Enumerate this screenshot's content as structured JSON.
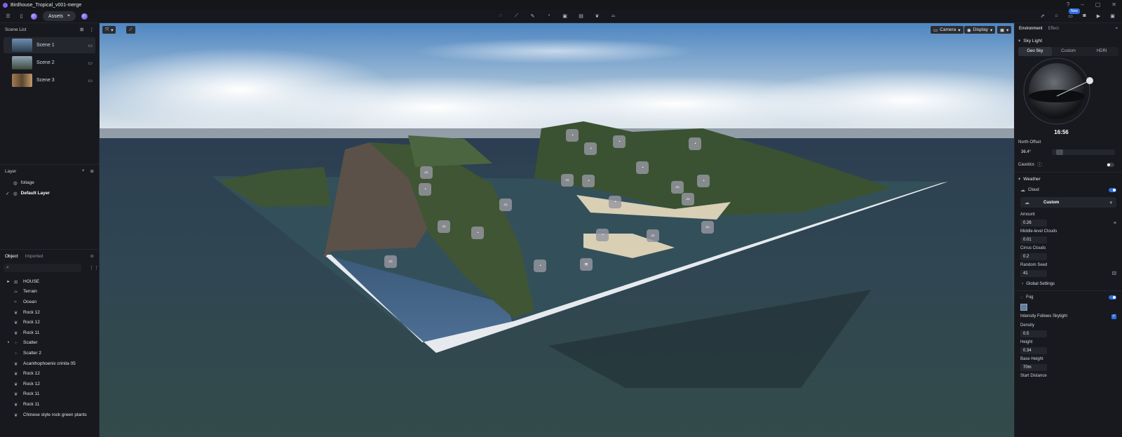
{
  "app": {
    "title": "Birdhouse_Tropical_v001-merge"
  },
  "toolbar": {
    "assets_label": "Assets",
    "new_badge": "New"
  },
  "scene_list": {
    "header": "Scene List",
    "scenes": [
      {
        "label": "Scene 1"
      },
      {
        "label": "Scene 2"
      },
      {
        "label": "Scene 3"
      }
    ]
  },
  "layer": {
    "header": "Layer",
    "items": [
      {
        "label": "foliage"
      },
      {
        "label": "Default Layer"
      }
    ]
  },
  "object_panel": {
    "tabs": [
      "Object",
      "Imported"
    ],
    "items": [
      {
        "label": "HOUSE",
        "icon": "group-icon"
      },
      {
        "label": "Terrain",
        "icon": "terrain-icon"
      },
      {
        "label": "Ocean",
        "icon": "ocean-icon"
      },
      {
        "label": "Rock 12",
        "icon": "leaf-icon"
      },
      {
        "label": "Rock 12",
        "icon": "leaf-icon"
      },
      {
        "label": "Rock 11",
        "icon": "leaf-icon"
      },
      {
        "label": "Scatter",
        "icon": "scatter-icon"
      },
      {
        "label": "Scatter 2",
        "icon": "scatter-icon"
      },
      {
        "label": "Acanthophoenix crinita 05",
        "icon": "leaf-icon"
      },
      {
        "label": "Rock 12",
        "icon": "leaf-icon"
      },
      {
        "label": "Rock 12",
        "icon": "leaf-icon"
      },
      {
        "label": "Rock 11",
        "icon": "leaf-icon"
      },
      {
        "label": "Rock 11",
        "icon": "leaf-icon"
      },
      {
        "label": "Chinese style rock green plants",
        "icon": "leaf-icon"
      }
    ]
  },
  "viewport": {
    "camera_label": "Camera",
    "display_label": "Display"
  },
  "right_panel": {
    "tabs": [
      "Environment",
      "Effect"
    ],
    "sky_light": {
      "header": "Sky Light",
      "modes": [
        "Geo Sky",
        "Custom",
        "HDRI"
      ],
      "time": "16:56",
      "north_offset_label": "North Offset",
      "north_offset_value": "36.4°",
      "caustics_label": "Caustics"
    },
    "weather": {
      "header": "Weather",
      "cloud_label": "Cloud",
      "cloud_preset": "Custom",
      "amount_label": "Amount",
      "amount_value": "0.26",
      "middle_label": "Middle-level Clouds",
      "middle_value": "0.01",
      "cirrus_label": "Cirrus Clouds",
      "cirrus_value": "0.2",
      "seed_label": "Random Seed",
      "seed_value": "41",
      "global_label": "Global Settings",
      "fog_label": "Fog",
      "fog_color": "#5f7fa8",
      "intensity_label": "Intensity Follows Skylight",
      "density_label": "Density",
      "density_value": "0.5",
      "height_label": "Height",
      "height_value": "0.34",
      "base_height_label": "Base Height",
      "base_height_value": "70m",
      "start_distance_label": "Start Distance"
    }
  },
  "colors": {
    "accent": "#2f6fe0",
    "brand": "#8d5cf6"
  }
}
